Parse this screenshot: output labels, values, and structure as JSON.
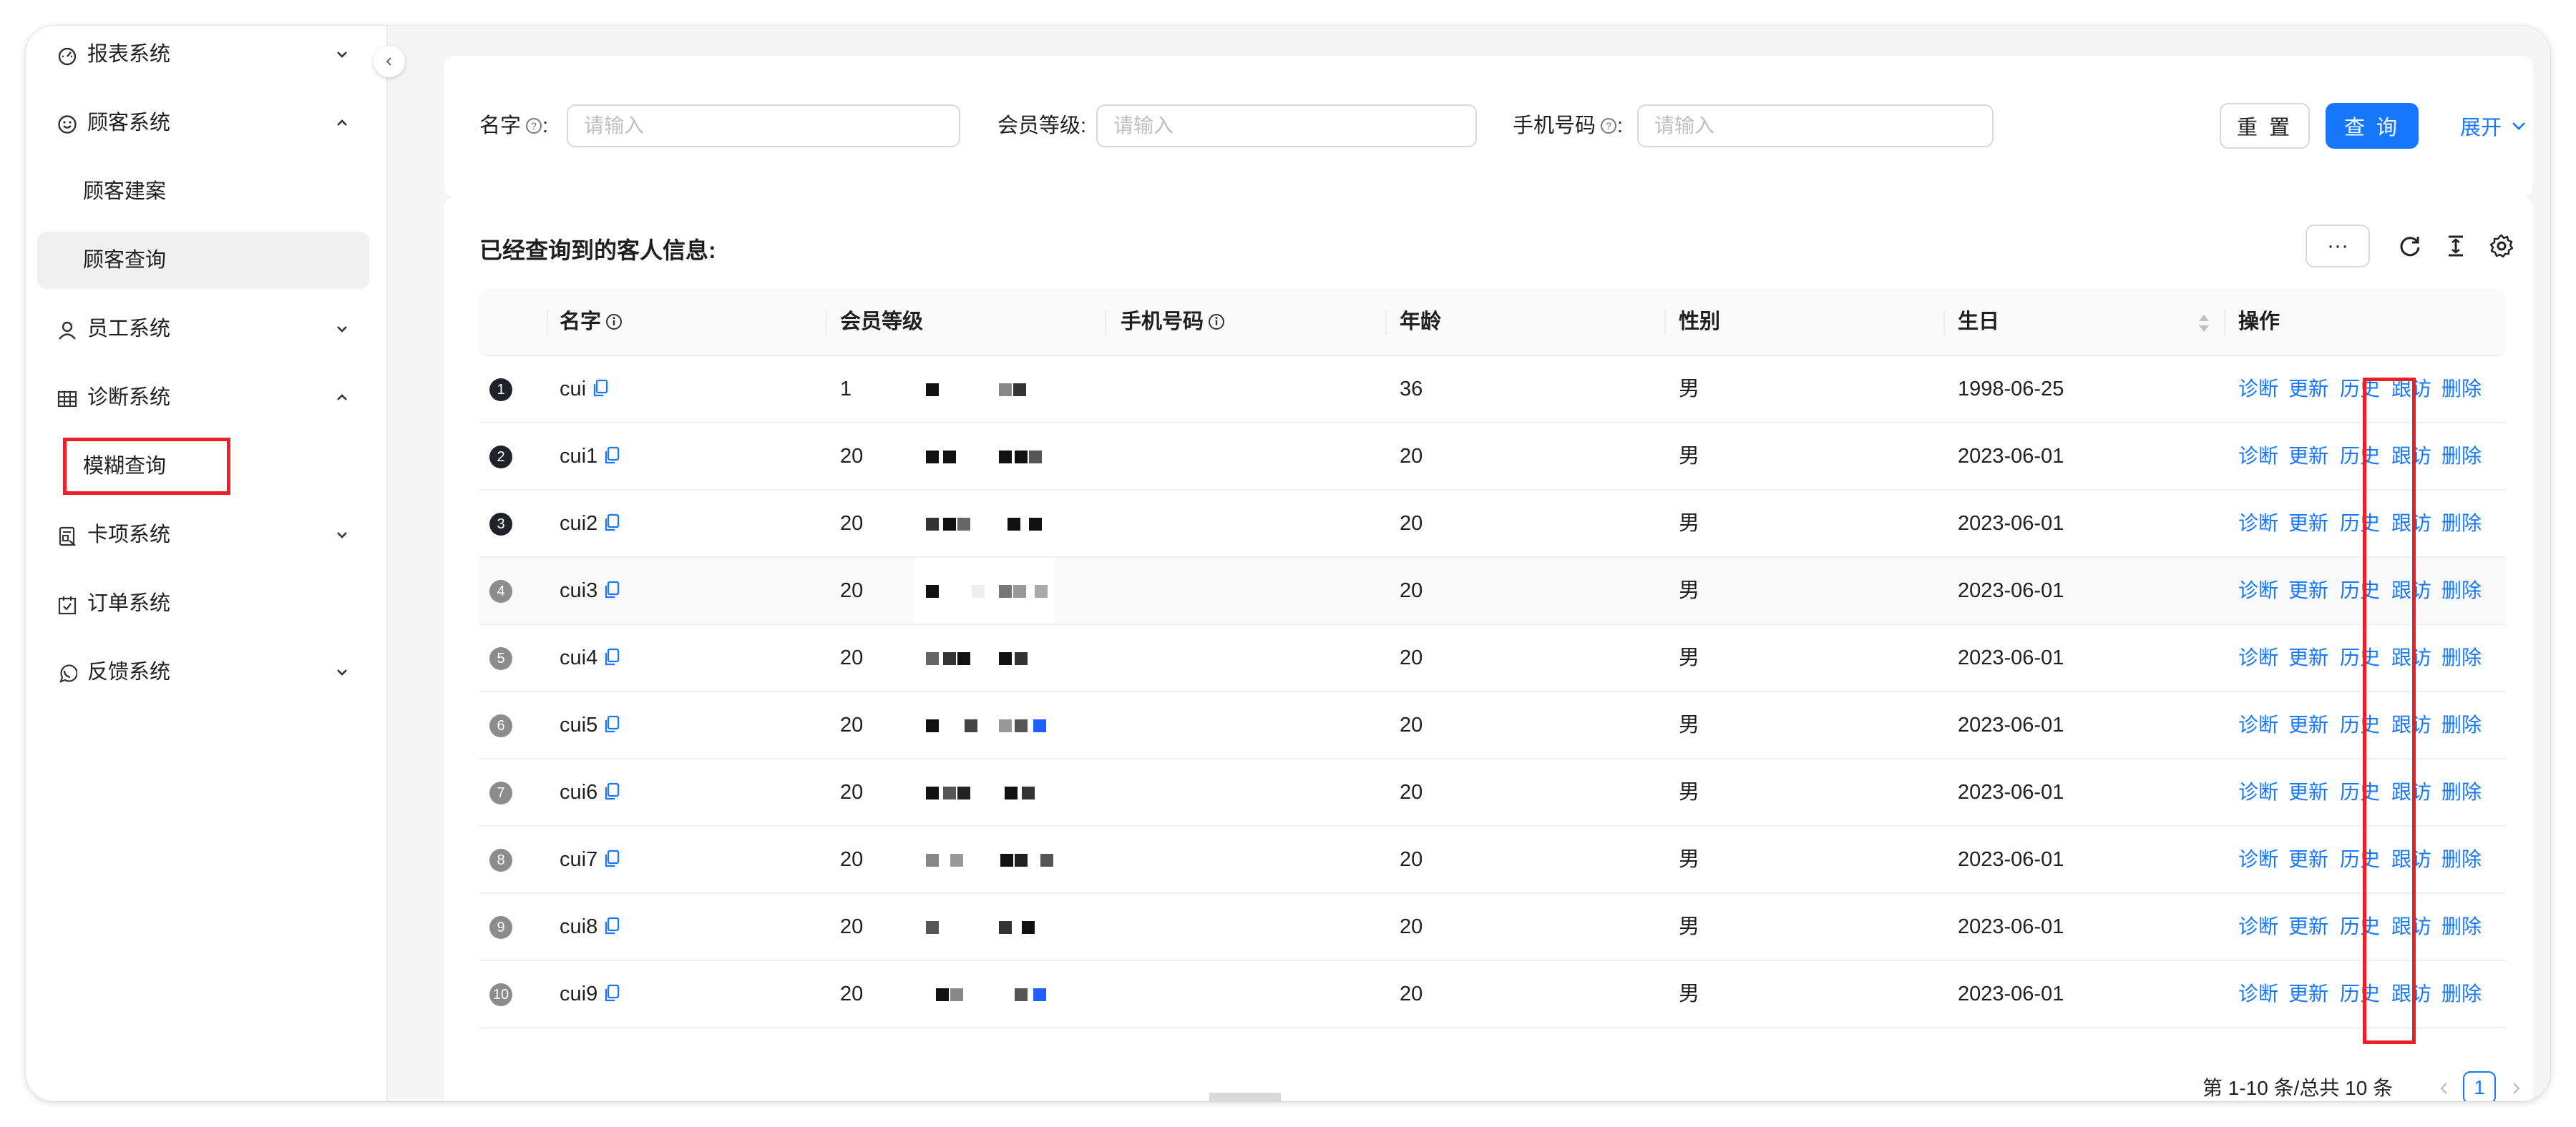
{
  "sidebar": {
    "items": [
      {
        "label": "报表系统",
        "icon": "dashboard-icon",
        "chevron": "down"
      },
      {
        "label": "顾客系统",
        "icon": "smile-icon",
        "chevron": "up"
      },
      {
        "label": "员工系统",
        "icon": "user-icon",
        "chevron": "down"
      },
      {
        "label": "诊断系统",
        "icon": "table-icon",
        "chevron": "up"
      },
      {
        "label": "卡项系统",
        "icon": "card-icon",
        "chevron": "down"
      },
      {
        "label": "订单系统",
        "icon": "calendar-icon",
        "chevron": ""
      },
      {
        "label": "反馈系统",
        "icon": "whatsapp-icon",
        "chevron": "down"
      }
    ],
    "sub_customer": [
      "顾客建案",
      "顾客查询"
    ],
    "sub_diagnosis": [
      "模糊查询"
    ],
    "active_submenu": "顾客查询",
    "highlighted_submenu": "模糊查询"
  },
  "search": {
    "name_label": "名字",
    "level_label": "会员等级",
    "phone_label": "手机号码",
    "colon": ":",
    "placeholder": "请输入",
    "reset_label": "重 置",
    "query_label": "查 询",
    "expand_label": "展开"
  },
  "table": {
    "title": "已经查询到的客人信息:",
    "more_label": "···",
    "columns": [
      "名字",
      "会员等级",
      "手机号码",
      "年龄",
      "性别",
      "生日",
      "操作"
    ],
    "actions": [
      "诊断",
      "更新",
      "历史",
      "跟访",
      "删除"
    ],
    "rows": [
      {
        "index": "1",
        "name": "cui",
        "level": "1",
        "age": "36",
        "gender": "男",
        "birthday": "1998-06-25"
      },
      {
        "index": "2",
        "name": "cui1",
        "level": "20",
        "age": "20",
        "gender": "男",
        "birthday": "2023-06-01"
      },
      {
        "index": "3",
        "name": "cui2",
        "level": "20",
        "age": "20",
        "gender": "男",
        "birthday": "2023-06-01"
      },
      {
        "index": "4",
        "name": "cui3",
        "level": "20",
        "age": "20",
        "gender": "男",
        "birthday": "2023-06-01"
      },
      {
        "index": "5",
        "name": "cui4",
        "level": "20",
        "age": "20",
        "gender": "男",
        "birthday": "2023-06-01"
      },
      {
        "index": "6",
        "name": "cui5",
        "level": "20",
        "age": "20",
        "gender": "男",
        "birthday": "2023-06-01"
      },
      {
        "index": "7",
        "name": "cui6",
        "level": "20",
        "age": "20",
        "gender": "男",
        "birthday": "2023-06-01"
      },
      {
        "index": "8",
        "name": "cui7",
        "level": "20",
        "age": "20",
        "gender": "男",
        "birthday": "2023-06-01"
      },
      {
        "index": "9",
        "name": "cui8",
        "level": "20",
        "age": "20",
        "gender": "男",
        "birthday": "2023-06-01"
      },
      {
        "index": "10",
        "name": "cui9",
        "level": "20",
        "age": "20",
        "gender": "男",
        "birthday": "2023-06-01"
      }
    ]
  },
  "pagination": {
    "summary": "第 1-10 条/总共 10 条",
    "current_page": "1"
  },
  "colors": {
    "primary": "#1677ff",
    "highlight_box": "#e8202a"
  }
}
